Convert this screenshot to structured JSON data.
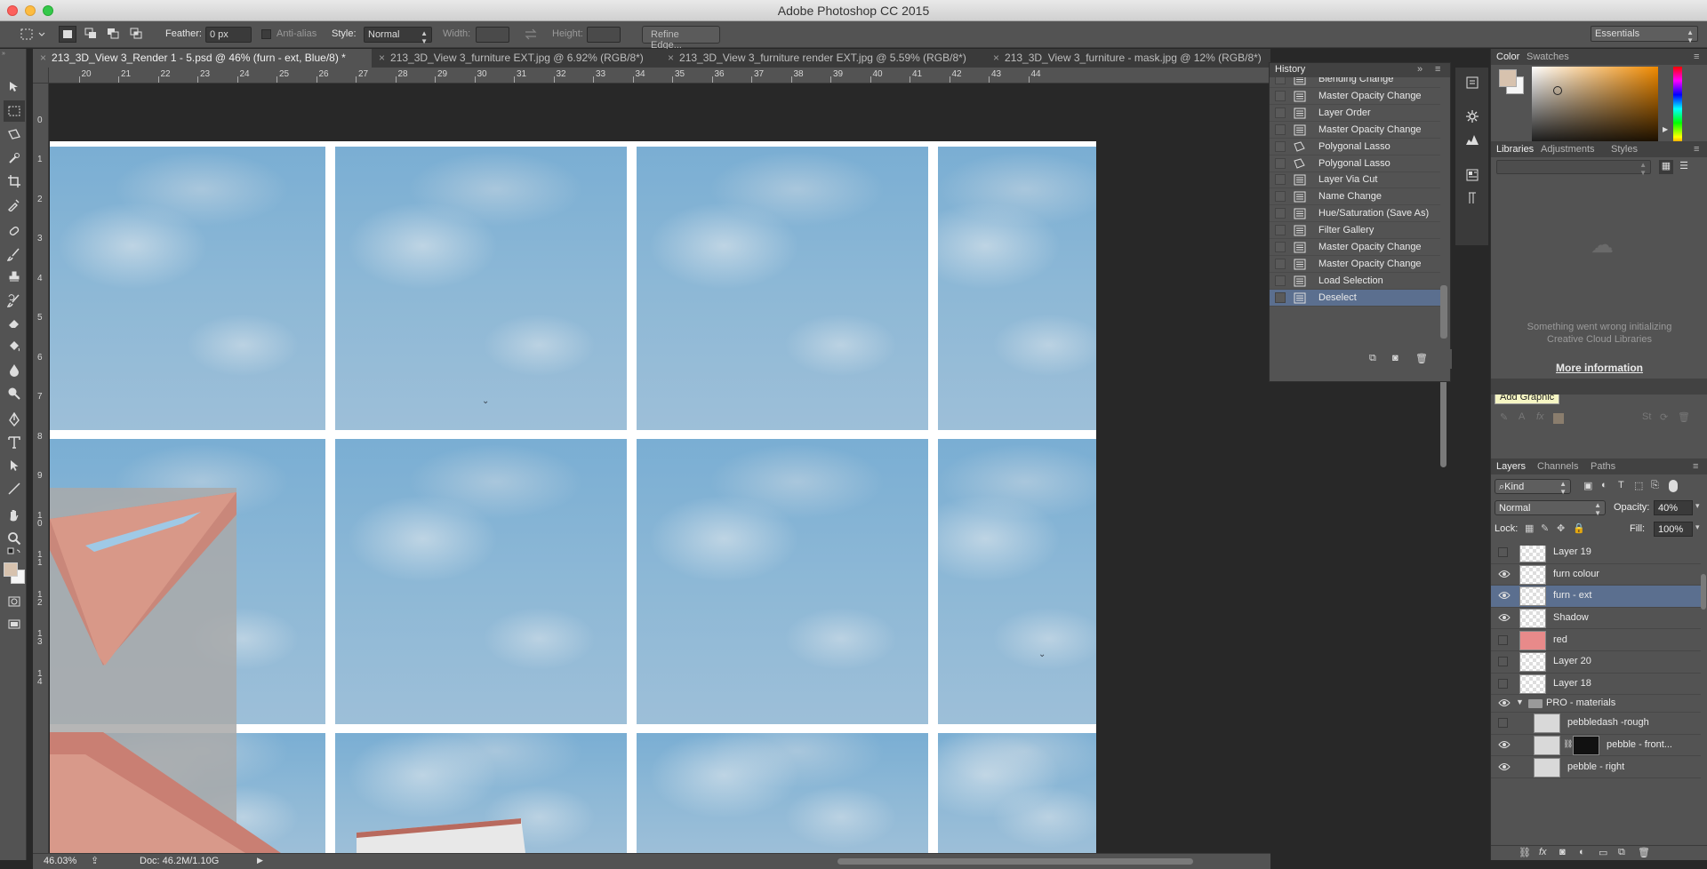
{
  "window": {
    "title": "Adobe Photoshop CC 2015"
  },
  "options_bar": {
    "feather_label": "Feather:",
    "feather_value": "0 px",
    "antialias_label": "Anti-alias",
    "style_label": "Style:",
    "style_value": "Normal",
    "width_label": "Width:",
    "height_label": "Height:",
    "refine_edge_label": "Refine Edge...",
    "workspace_value": "Essentials"
  },
  "doc_tabs": [
    {
      "label": "213_3D_View 3_Render 1 - 5.psd @ 46% (furn - ext, Blue/8) *",
      "active": true
    },
    {
      "label": "213_3D_View 3_furniture EXT.jpg @ 6.92% (RGB/8*)",
      "active": false
    },
    {
      "label": "213_3D_View 3_furniture render EXT.jpg @ 5.59% (RGB/8*)",
      "active": false
    },
    {
      "label": "213_3D_View 3_furniture - mask.jpg @ 12% (RGB/8*)",
      "active": false
    }
  ],
  "ruler_h": [
    "9",
    "20",
    "21",
    "22",
    "23",
    "24",
    "25",
    "26",
    "27",
    "28",
    "29",
    "30",
    "31",
    "32",
    "33",
    "34",
    "35",
    "36",
    "37",
    "38",
    "39",
    "40",
    "41",
    "42",
    "43",
    "44"
  ],
  "ruler_v": [
    "1",
    "0",
    "1",
    "2",
    "3",
    "4",
    "5",
    "6",
    "7",
    "8",
    "9",
    "1\n0",
    "1\n1",
    "1\n2",
    "1\n3",
    "1\n4"
  ],
  "history": {
    "title": "History",
    "items": [
      {
        "label": "Blending Change",
        "icon": "doc-icon",
        "selected": false
      },
      {
        "label": "Master Opacity Change",
        "icon": "doc-icon",
        "selected": false
      },
      {
        "label": "Layer Order",
        "icon": "doc-icon",
        "selected": false
      },
      {
        "label": "Master Opacity Change",
        "icon": "doc-icon",
        "selected": false
      },
      {
        "label": "Polygonal Lasso",
        "icon": "lasso-icon",
        "selected": false
      },
      {
        "label": "Polygonal Lasso",
        "icon": "lasso-icon",
        "selected": false
      },
      {
        "label": "Layer Via Cut",
        "icon": "doc-icon",
        "selected": false
      },
      {
        "label": "Name Change",
        "icon": "doc-icon",
        "selected": false
      },
      {
        "label": "Hue/Saturation (Save As)",
        "icon": "doc-icon",
        "selected": false
      },
      {
        "label": "Filter Gallery",
        "icon": "doc-icon",
        "selected": false
      },
      {
        "label": "Master Opacity Change",
        "icon": "doc-icon",
        "selected": false
      },
      {
        "label": "Master Opacity Change",
        "icon": "doc-icon",
        "selected": false
      },
      {
        "label": "Load Selection",
        "icon": "doc-icon",
        "selected": false
      },
      {
        "label": "Deselect",
        "icon": "doc-icon",
        "selected": true
      }
    ]
  },
  "color_panel": {
    "tab_color": "Color",
    "tab_swatches": "Swatches",
    "fg_color": "#d7c2ae",
    "bg_color": "#f5f5f5"
  },
  "libraries": {
    "tab_libraries": "Libraries",
    "tab_adjustments": "Adjustments",
    "tab_styles": "Styles",
    "error_line1": "Something went wrong initializing",
    "error_line2": "Creative Cloud Libraries",
    "more_info": "More information",
    "tooltip": "Add Graphic"
  },
  "layers_panel": {
    "tab_layers": "Layers",
    "tab_channels": "Channels",
    "tab_paths": "Paths",
    "kind_label": "Kind",
    "blend_mode": "Normal",
    "opacity_label": "Opacity:",
    "opacity_value": "40%",
    "lock_label": "Lock:",
    "fill_label": "Fill:",
    "fill_value": "100%",
    "layers": [
      {
        "name": "Layer 19",
        "visible": false,
        "selected": false,
        "thumb": "transparent",
        "indent": 0
      },
      {
        "name": "furn colour",
        "visible": true,
        "selected": false,
        "thumb": "transparent",
        "indent": 0
      },
      {
        "name": "furn - ext",
        "visible": true,
        "selected": true,
        "thumb": "transparent",
        "indent": 0
      },
      {
        "name": "Shadow",
        "visible": true,
        "selected": false,
        "thumb": "transparent",
        "indent": 0
      },
      {
        "name": "red",
        "visible": false,
        "selected": false,
        "thumb": "red",
        "indent": 0
      },
      {
        "name": "Layer 20",
        "visible": false,
        "selected": false,
        "thumb": "transparent",
        "indent": 0
      },
      {
        "name": "Layer 18",
        "visible": false,
        "selected": false,
        "thumb": "transparent",
        "indent": 0
      },
      {
        "name": "PRO - materials",
        "visible": true,
        "selected": false,
        "thumb": "folder",
        "indent": 0
      },
      {
        "name": "pebbledash -rough",
        "visible": false,
        "selected": false,
        "thumb": "texture",
        "indent": 1
      },
      {
        "name": "pebble - front...",
        "visible": true,
        "selected": false,
        "thumb": "masked",
        "indent": 1
      },
      {
        "name": "pebble - right",
        "visible": true,
        "selected": false,
        "thumb": "texture",
        "indent": 1
      }
    ]
  },
  "status": {
    "zoom": "46.03%",
    "doc": "Doc: 46.2M/1.10G"
  }
}
